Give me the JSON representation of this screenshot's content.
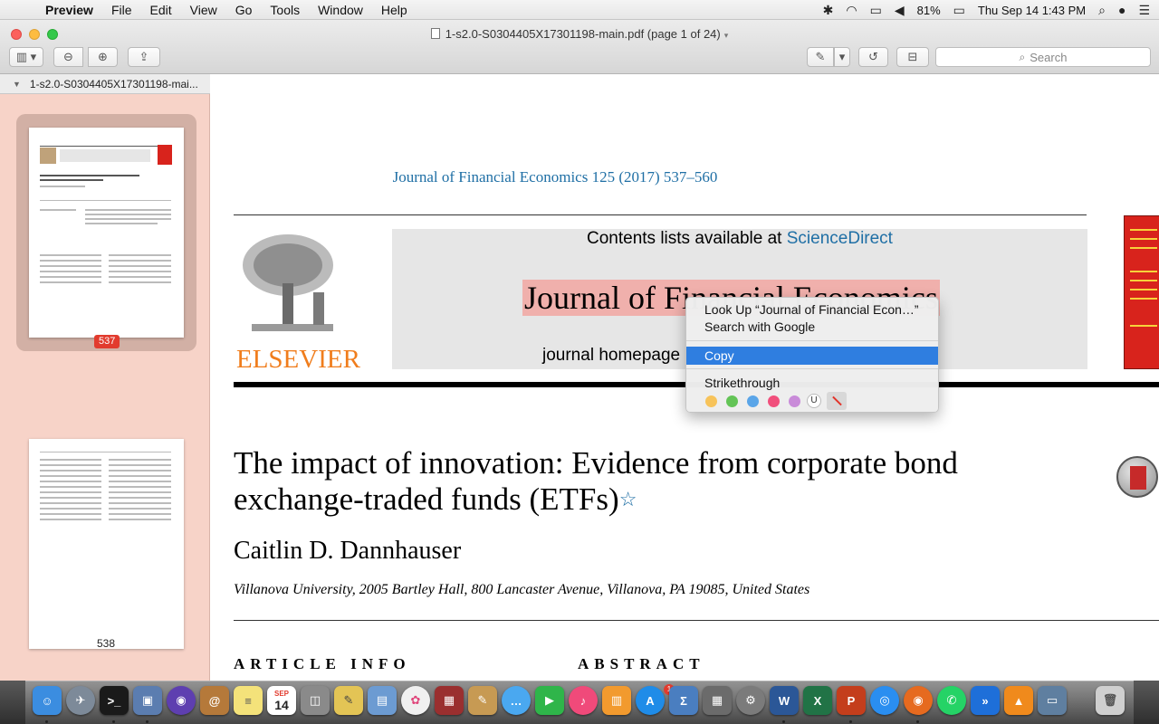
{
  "menubar": {
    "app": "Preview",
    "items": [
      "File",
      "Edit",
      "View",
      "Go",
      "Tools",
      "Window",
      "Help"
    ],
    "battery": "81%",
    "clock": "Thu Sep 14  1:43 PM"
  },
  "window": {
    "title": "1-s2.0-S0304405X17301198-main.pdf (page 1 of 24)",
    "search_placeholder": "Search"
  },
  "sidebar": {
    "header": "1-s2.0-S0304405X17301198-mai...",
    "pages": [
      {
        "label": "537",
        "selected": true
      },
      {
        "label": "538",
        "selected": false
      }
    ]
  },
  "document": {
    "journal_ref": "Journal of Financial Economics 125 (2017) 537–560",
    "contents_prefix": "Contents lists available at",
    "contents_link": "ScienceDirect",
    "journal_title": "Journal of Financial Economics",
    "homepage_label": "journal homepage",
    "publisher": "ELSEVIER",
    "article_title_line1": "The impact of innovation: Evidence from corporate bond",
    "article_title_line2": "exchange-traded funds (ETFs)",
    "title_footnote_mark": "☆",
    "author": "Caitlin D. Dannhauser",
    "affiliation": "Villanova University, 2005 Bartley Hall, 800 Lancaster Avenue, Villanova, PA 19085, United States",
    "section_info": "ARTICLE INFO",
    "section_abstract": "ABSTRACT"
  },
  "context_menu": {
    "lookup": "Look Up “Journal of Financial Econ…”",
    "search_google": "Search with Google",
    "copy": "Copy",
    "strikethrough": "Strikethrough",
    "colors": [
      "#f7c35a",
      "#63c456",
      "#5aa5e8",
      "#f14f7c",
      "#c98bd9"
    ],
    "underline_glyph": "U"
  },
  "dock": {
    "calendar_month": "SEP",
    "calendar_day": "14",
    "appstore_badge": "1"
  }
}
